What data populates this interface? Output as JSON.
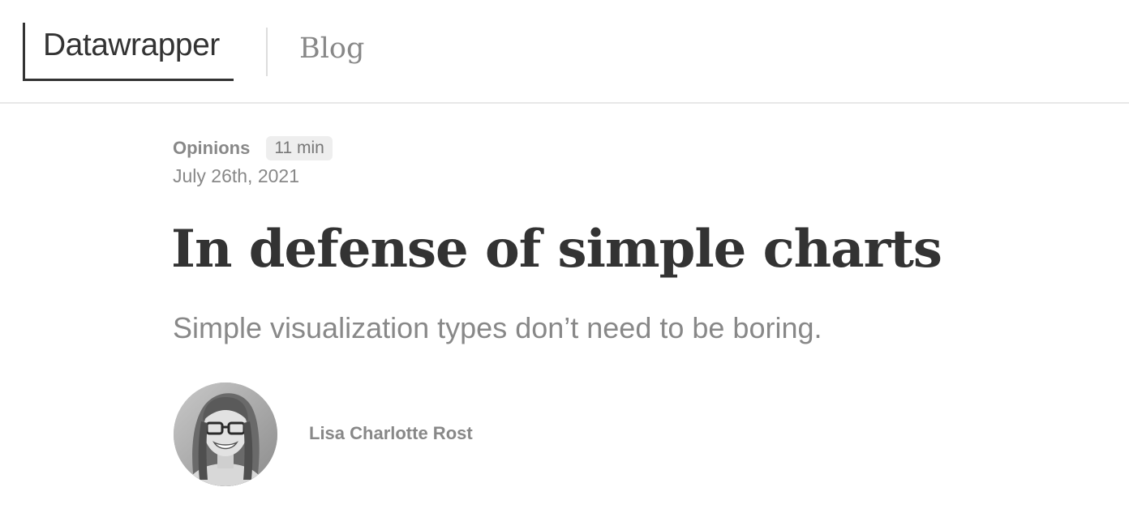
{
  "header": {
    "logo_text": "Datawrapper",
    "section_link": "Blog"
  },
  "article": {
    "category": "Opinions",
    "read_time": "11 min",
    "date": "July 26th, 2021",
    "title": "In defense of simple charts",
    "subtitle": "Simple visualization types don’t need to be boring.",
    "author": {
      "name": "Lisa Charlotte Rost",
      "avatar": "author-portrait-photo"
    }
  },
  "colors": {
    "text_dark": "#333333",
    "text_muted": "#888888",
    "badge_bg": "#eeeeee",
    "divider": "#e8e8e8"
  }
}
